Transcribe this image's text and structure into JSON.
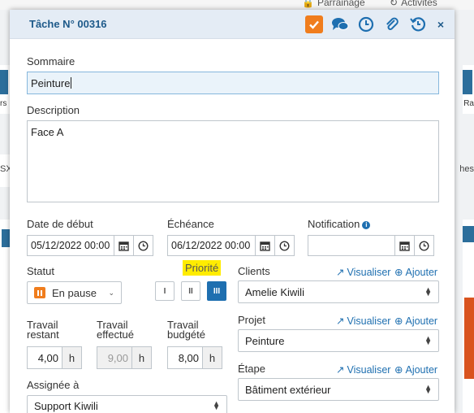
{
  "background": {
    "parrainage": "Parrainage",
    "activites": "Activités",
    "left_labels": [
      "rs",
      "SX"
    ],
    "right_labels": [
      "Ra",
      "hes"
    ]
  },
  "modal": {
    "title": "Tâche N° 00316",
    "icons": [
      "check-icon",
      "comments-icon",
      "clock-icon",
      "paperclip-icon",
      "history-icon",
      "close-icon"
    ],
    "close_glyph": "×"
  },
  "form": {
    "sommaire_label": "Sommaire",
    "sommaire_value": "Peinture",
    "description_label": "Description",
    "description_value": "Face A",
    "date_debut_label": "Date de début",
    "date_debut_value": "05/12/2022 00:00",
    "echeance_label": "Échéance",
    "echeance_value": "06/12/2022 00:00",
    "notification_label": "Notification",
    "notification_value": "",
    "statut_label": "Statut",
    "statut_value": "En pause",
    "priorite_label": "Priorité",
    "priorite_options": [
      "I",
      "II",
      "III"
    ],
    "priorite_selected": "III",
    "clients_label": "Clients",
    "visualiser": "Visualiser",
    "ajouter": "Ajouter",
    "clients_value": "Amelie Kiwili",
    "projet_label": "Projet",
    "projet_value": "Peinture",
    "etape_label": "Étape",
    "etape_value": "Bâtiment extérieur",
    "travail_restant_label": "Travail restant",
    "travail_restant_value": "4,00",
    "travail_effectue_label": "Travail effectué",
    "travail_effectue_value": "9,00",
    "travail_budgete_label": "Travail budgété",
    "travail_budgete_value": "8,00",
    "unit": "h",
    "assignee_label": "Assignée à",
    "assignee_value": "Support Kiwili"
  },
  "colors": {
    "accent": "#1e6fb0",
    "check": "#f07d1d",
    "highlight": "#ffec00",
    "header_bg": "#e4ecf5"
  }
}
